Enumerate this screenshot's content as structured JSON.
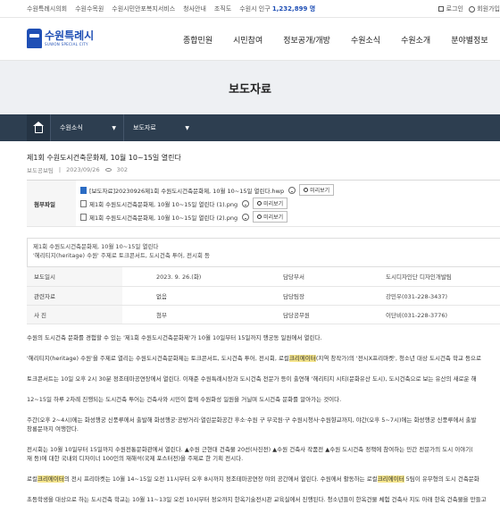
{
  "topbar": {
    "links": [
      "수원특례시의회",
      "수원수목원",
      "수원시민안포복지서비스",
      "청사안내",
      "조직도"
    ],
    "population_label": "수원시 인구",
    "population_value": "1,232,899 명",
    "login": "로그인",
    "signup": "회원가입"
  },
  "logo": {
    "kr": "수원특례시",
    "en": "SUWON SPECIAL CITY"
  },
  "gnb": [
    "종합민원",
    "시민참여",
    "정보공개/개방",
    "수원소식",
    "수원소개",
    "분야별정보"
  ],
  "hero_title": "보도자료",
  "breadcrumb": [
    "수원소식",
    "보도자료"
  ],
  "article": {
    "title": "제1회 수원도시건축문화제, 10월 10~15일 열린다",
    "dept": "보도공보팀",
    "date": "2023/09/26",
    "views": "302"
  },
  "attachments": {
    "label": "첨부파일",
    "preview_label": "미리보기",
    "files": [
      {
        "name": "[보도자료]20230926제1회 수원도시건축문화제, 10월 10~15일 열린다.hwp",
        "icon": "hwp-file-icon"
      },
      {
        "name": "제1회 수원도시건축문화제, 10월 10~15일 열린다 (1).png",
        "icon": "image-file-icon"
      },
      {
        "name": "제1회 수원도시건축문화제, 10월 10~15일 열린다 (2).png",
        "icon": "image-file-icon"
      }
    ]
  },
  "summary": [
    "제1회 수원도시건축문화제, 10월 10~15일 열린다",
    "'헤리티지(heritage) 수원' 주제로 토크콘서트, 도시건축 투어, 전시회 등"
  ],
  "info_table": [
    [
      "보도일시",
      "2023. 9. 26.(화)",
      "담당부서",
      "도시디자인단 디자인개발팀"
    ],
    [
      "관련자료",
      "없음",
      "담당팀장",
      "강민우(031-228-3437)"
    ],
    [
      "사 진",
      "첨부",
      "담당공무원",
      "이단비(031-228-3776)"
    ]
  ],
  "body": {
    "p1": "수원의 도시건축 문화를 경험할 수 있는 '제1회 수원도시건축문화제'가 10월 10일부터 15일까지 행궁동 일원에서 열린다.",
    "p2a": "'헤리티지(heritage) 수원'을 주제로 열리는 수원도시건축문화제는 토크콘서트, 도시건축 투어, 전시회, 로컬",
    "p2hl": "크리에이터",
    "p2b": "(지역 창작가)의 '전시X프리마켓', 청소년 대상 도시건축 학교 등으로",
    "p3": "토크콘서트는 10일 오후 2시 30분 정조테마공연장에서 열린다. 이재준 수원특례시장과 도시건축 전문가 등이 출연해 '헤리티지 시티(문화유산 도시), 도시건축으로 보는 유산의 새로운 해",
    "p4": "12~15일 하루 2차례 진행되는 도시건축 투어는 건축사와 시민이 함께 수원화성 일원을 거닐며 도시건축 문화를 알아가는 것이다.",
    "p5a": "주간(오후 2~4시)에는 화성행궁 신풍루에서 출발해 화성행궁·공방거리·열린문화공간 후소·수원 구 부국원·구 수원시청사·수원향교까지, 야간(오후 5~7시)에는 화성행궁 신풍루에서 출발",
    "p5b": "창룡문까지 여행한다.",
    "p6a": "전시회는 10월 10일부터 15일까지 수원전통문화관에서 열린다. ▲수원 근현대 건축물 20선(사진전) ▲수원 건축사 작품전 ▲수원 도시건축 정책에 참여하는 민간 전문가의 도시 이야기(",
    "p6b": "재 등)에 대한 국내외 디자이너 100인의 재해석(국제 포스터전)을 주제로 한 기획 전시다.",
    "p7a": "로컬",
    "p7hl": "크리에이터",
    "p7b": "의 전시 프리마켓는 10월 14~15일 오전 11시부터 오후 8시까지 정조테마공연장 야외 공간에서 열린다. 수원에서 활동하는 로컬",
    "p7hl2": "크리에이터",
    "p7c": " 5팀이 유무형의 도시 건축문화",
    "p8": "초등학생을 대상으로 하는 도시건축 학교는 10월 11~13일 오전 10시부터 정오까지 한옥기술전시관 교육실에서 진행된다. 청소년들이 한옥건물 체험 건축사 지도 아래 한옥 건축물을 만들고"
  }
}
